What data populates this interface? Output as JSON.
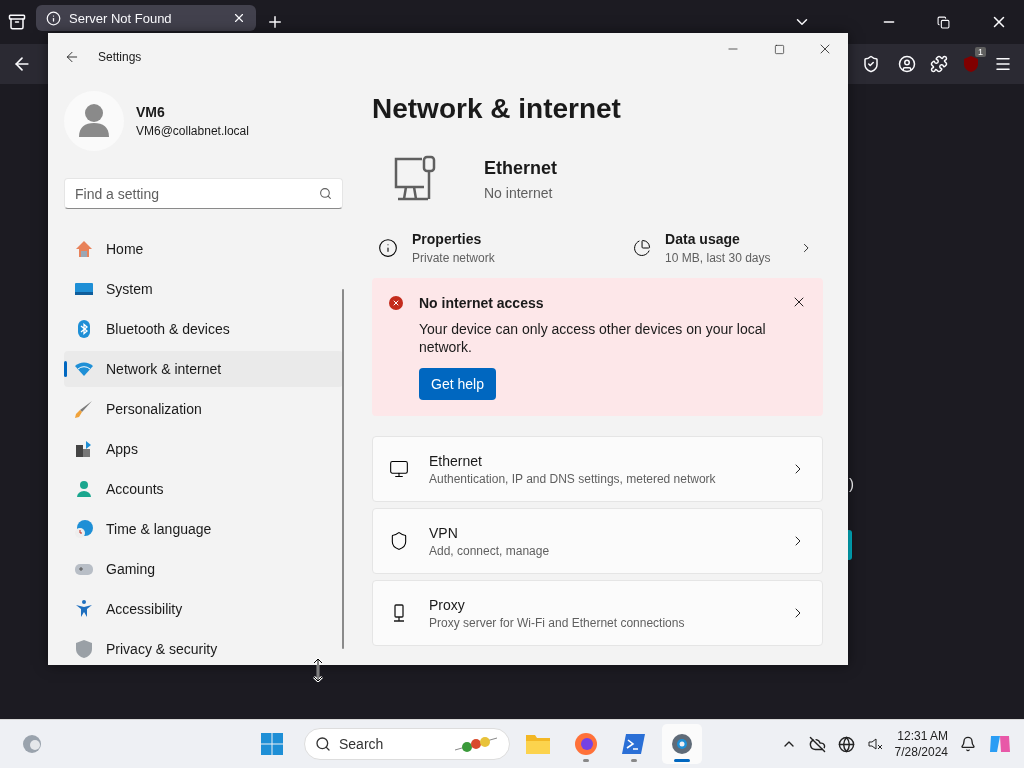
{
  "browser": {
    "tabs": [
      {
        "title": "Server Not Found",
        "selected": true
      }
    ],
    "extension_badge": "1",
    "page_fragment": ")"
  },
  "settings": {
    "title": "Settings",
    "user": {
      "name": "VM6",
      "email": "VM6@collabnet.local"
    },
    "search": {
      "placeholder": "Find a setting"
    },
    "nav": [
      {
        "kind": "home",
        "label": "Home",
        "selected": false
      },
      {
        "kind": "system",
        "label": "System",
        "selected": false
      },
      {
        "kind": "bluetooth",
        "label": "Bluetooth & devices",
        "selected": false
      },
      {
        "kind": "network",
        "label": "Network & internet",
        "selected": true
      },
      {
        "kind": "personalization",
        "label": "Personalization",
        "selected": false
      },
      {
        "kind": "apps",
        "label": "Apps",
        "selected": false
      },
      {
        "kind": "accounts",
        "label": "Accounts",
        "selected": false
      },
      {
        "kind": "time",
        "label": "Time & language",
        "selected": false
      },
      {
        "kind": "gaming",
        "label": "Gaming",
        "selected": false
      },
      {
        "kind": "accessibility",
        "label": "Accessibility",
        "selected": false
      },
      {
        "kind": "privacy",
        "label": "Privacy & security",
        "selected": false
      }
    ],
    "page_title": "Network & internet",
    "connection": {
      "name": "Ethernet",
      "status": "No internet"
    },
    "properties": {
      "title": "Properties",
      "subtitle": "Private network"
    },
    "data_usage": {
      "title": "Data usage",
      "subtitle": "10 MB, last 30 days"
    },
    "alert": {
      "title": "No internet access",
      "message": "Your device can only access other devices on your local network.",
      "button": "Get help"
    },
    "items": [
      {
        "kind": "ethernet",
        "title": "Ethernet",
        "subtitle": "Authentication, IP and DNS settings, metered network"
      },
      {
        "kind": "vpn",
        "title": "VPN",
        "subtitle": "Add, connect, manage"
      },
      {
        "kind": "proxy",
        "title": "Proxy",
        "subtitle": "Proxy server for Wi-Fi and Ethernet connections"
      }
    ]
  },
  "taskbar": {
    "search": {
      "placeholder": "Search"
    },
    "apps": [
      {
        "kind": "explorer",
        "running": false,
        "selected": false
      },
      {
        "kind": "firefox",
        "running": true,
        "selected": false
      },
      {
        "kind": "terminal",
        "running": true,
        "selected": false
      },
      {
        "kind": "settings",
        "running": true,
        "selected": true
      }
    ],
    "time": "12:31 AM",
    "date": "7/28/2024"
  }
}
